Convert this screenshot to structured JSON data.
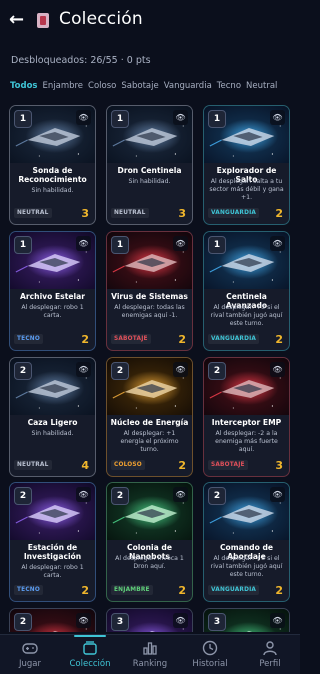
{
  "header": {
    "title": "Colección"
  },
  "stats": "Desbloqueados: 26/55 · 0 pts",
  "filters": [
    "Todos",
    "Enjambre",
    "Coloso",
    "Sabotaje",
    "Vanguardia",
    "Tecno",
    "Neutral"
  ],
  "active_filter": "Todos",
  "colors": {
    "accent": "#3fc5d6",
    "power": "#f0b62c",
    "NEUTRAL": "#b9c0d0",
    "VANGUARDIA": "#3fc5d6",
    "TECNO": "#5a9bf0",
    "SABOTAJE": "#e0505a",
    "COLOSO": "#f0a030",
    "ENJAMBRE": "#5fd07a"
  },
  "cards": [
    {
      "cost": "1",
      "name": "Sonda de Reconocimiento",
      "desc": "Sin habilidad.",
      "faction": "NEUTRAL",
      "power": "3",
      "art": "neutral"
    },
    {
      "cost": "1",
      "name": "Dron Centinela",
      "desc": "Sin habilidad.",
      "faction": "NEUTRAL",
      "power": "3",
      "art": "neutral"
    },
    {
      "cost": "1",
      "name": "Explorador de Salto",
      "desc": "Al desplegar: salta a tu sector más débil y gana +1.",
      "faction": "VANGUARDIA",
      "power": "2",
      "art": "vanguard"
    },
    {
      "cost": "1",
      "name": "Archivo Estelar",
      "desc": "Al desplegar: robo 1 carta.",
      "faction": "TECNO",
      "power": "2",
      "art": "tecno"
    },
    {
      "cost": "1",
      "name": "Virus de Sistemas",
      "desc": "Al desplegar: todas las enemigas aquí -1.",
      "faction": "SABOTAJE",
      "power": "2",
      "art": "sabotaje"
    },
    {
      "cost": "1",
      "name": "Centinela Avanzado",
      "desc": "Al desplegar: +3 si el rival también jugó aquí este turno.",
      "faction": "VANGUARDIA",
      "power": "2",
      "art": "vanguard"
    },
    {
      "cost": "2",
      "name": "Caza Ligero",
      "desc": "Sin habilidad.",
      "faction": "NEUTRAL",
      "power": "4",
      "art": "neutral"
    },
    {
      "cost": "2",
      "name": "Núcleo de Energía",
      "desc": "Al desplegar: +1 energía el próximo turno.",
      "faction": "COLOSO",
      "power": "2",
      "art": "coloso"
    },
    {
      "cost": "2",
      "name": "Interceptor EMP",
      "desc": "Al desplegar: -2 a la enemiga más fuerte aquí.",
      "faction": "SABOTAJE",
      "power": "3",
      "art": "sabotaje"
    },
    {
      "cost": "2",
      "name": "Estación de Investigación",
      "desc": "Al desplegar: robo 1 carta.",
      "faction": "TECNO",
      "power": "2",
      "art": "tecno"
    },
    {
      "cost": "2",
      "name": "Colonia de Nanobots",
      "desc": "Al desplegar: invoca 1 Dron aquí.",
      "faction": "ENJAMBRE",
      "power": "2",
      "art": "enjambre"
    },
    {
      "cost": "2",
      "name": "Comando de Abordaje",
      "desc": "Al desplegar: +3 si el rival también jugó aquí este turno.",
      "faction": "VANGUARDIA",
      "power": "2",
      "art": "vanguard"
    }
  ],
  "partial_cards": [
    {
      "cost": "2",
      "art": "sabotaje"
    },
    {
      "cost": "3",
      "art": "tecno"
    },
    {
      "cost": "3",
      "art": "enjambre"
    }
  ],
  "nav": [
    {
      "label": "Jugar",
      "icon": "gamepad-icon"
    },
    {
      "label": "Colección",
      "icon": "cards-icon",
      "active": true
    },
    {
      "label": "Ranking",
      "icon": "bar-chart-icon"
    },
    {
      "label": "Historial",
      "icon": "clock-icon"
    },
    {
      "label": "Perfil",
      "icon": "user-icon"
    }
  ]
}
